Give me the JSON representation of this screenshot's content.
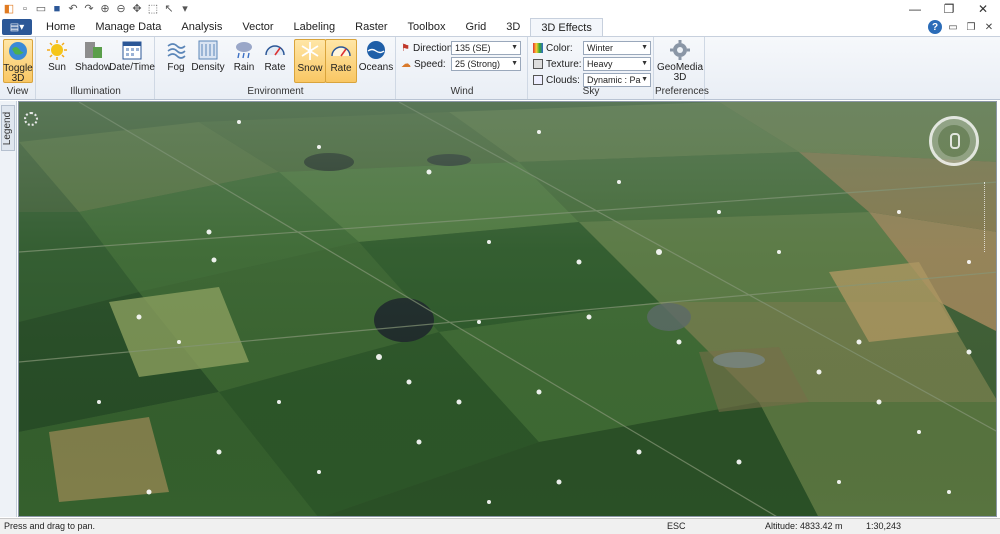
{
  "quick_access": {
    "icons": [
      "app-logo-icon",
      "new-icon",
      "open-icon",
      "save-icon",
      "undo-icon",
      "redo-icon",
      "zoom-in-icon",
      "zoom-out-icon",
      "pan-icon",
      "select-icon",
      "pointer-icon",
      "dropdown-icon"
    ]
  },
  "window_controls": {
    "minimize": "—",
    "restore": "❐",
    "close": "✕"
  },
  "tabs": [
    {
      "label": "Home"
    },
    {
      "label": "Manage Data"
    },
    {
      "label": "Analysis"
    },
    {
      "label": "Vector"
    },
    {
      "label": "Labeling"
    },
    {
      "label": "Raster"
    },
    {
      "label": "Toolbox"
    },
    {
      "label": "Grid"
    },
    {
      "label": "3D"
    },
    {
      "label": "3D Effects"
    }
  ],
  "active_tab": "3D Effects",
  "ribbon": {
    "view": {
      "label": "View",
      "toggle": "Toggle 3D"
    },
    "illumination": {
      "label": "Illumination",
      "sun": "Sun",
      "shadow": "Shadow",
      "datetime": "Date/Time"
    },
    "environment": {
      "label": "Environment",
      "fog": "Fog",
      "density": "Density",
      "rain": "Rain",
      "rain_rate": "Rate",
      "snow": "Snow",
      "snow_rate": "Rate",
      "oceans": "Oceans"
    },
    "wind": {
      "label": "Wind",
      "direction_label": "Direction:",
      "direction_value": "135 (SE)",
      "speed_label": "Speed:",
      "speed_value": "25 (Strong)"
    },
    "sky": {
      "label": "Sky",
      "color_label": "Color:",
      "color_value": "Winter",
      "texture_label": "Texture:",
      "texture_value": "Heavy",
      "clouds_label": "Clouds:",
      "clouds_value": "Dynamic : Parti"
    },
    "preferences": {
      "label": "Preferences",
      "geomedia": "GeoMedia 3D"
    }
  },
  "legend": {
    "label": "Legend"
  },
  "status": {
    "message": "Press and drag to pan.",
    "esc": "ESC",
    "altitude": "Altitude: 4833.42 m",
    "scale": "1:30,243"
  },
  "colors": {
    "accent": "#2b5797",
    "active_button": "#f9c764",
    "ribbon_bg": "#eef2f7"
  }
}
